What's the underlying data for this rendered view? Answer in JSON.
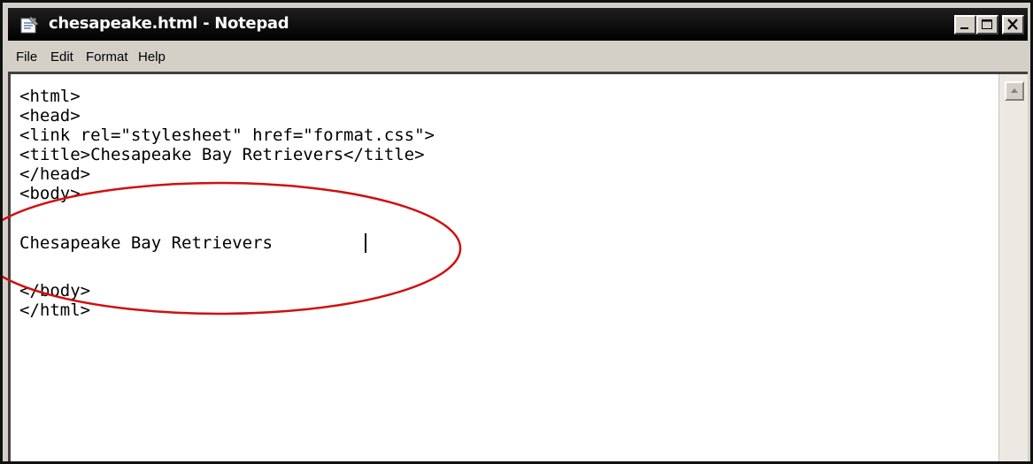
{
  "window": {
    "title": "chesapeake.html - Notepad"
  },
  "menu": {
    "file": "File",
    "edit": "Edit",
    "format": "Format",
    "help": "Help"
  },
  "editor": {
    "lines": [
      "<html>",
      "<head>",
      "<link rel=\"stylesheet\" href=\"format.css\">",
      "<title>Chesapeake Bay Retrievers</title>",
      "</head>",
      "<body>",
      "",
      "Chesapeake Bay Retrievers",
      "",
      "</body>",
      "</html>"
    ]
  },
  "colors": {
    "annotation_ellipse": "#d01010",
    "titlebar": "#000000",
    "chrome": "#d4d0c8"
  },
  "icons": {
    "app": "notepad-icon",
    "minimize": "minimize-icon",
    "maximize": "maximize-icon",
    "close": "close-icon",
    "scroll_up": "scroll-up-arrow-icon"
  }
}
